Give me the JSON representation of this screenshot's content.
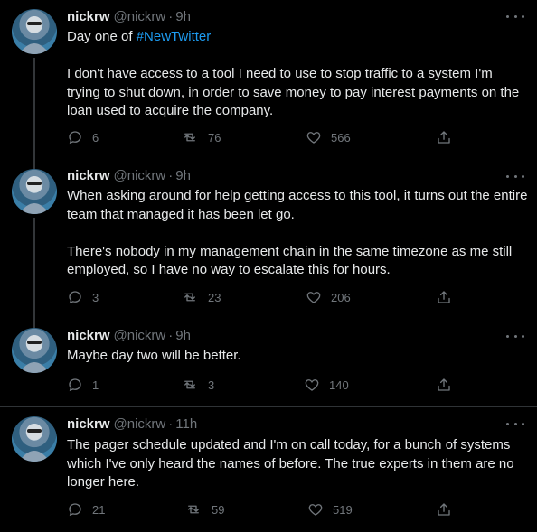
{
  "tweets": [
    {
      "name": "nickrw",
      "handle": "@nickrw",
      "time": "9h",
      "paragraphs": [
        "",
        "I don't have access to a tool I need to use to stop traffic to a system I'm trying to shut down, in order to save money to pay interest payments on the loan used to acquire the company."
      ],
      "first_line_prefix": "Day one of ",
      "hashtag": "#NewTwitter",
      "replies": "6",
      "retweets": "76",
      "likes": "566"
    },
    {
      "name": "nickrw",
      "handle": "@nickrw",
      "time": "9h",
      "paragraphs": [
        "When asking around for help getting access to this tool, it turns out the entire team that managed it has been let go.",
        "There's nobody in my management chain in the same timezone as me still employed, so I have no way to escalate this for hours."
      ],
      "replies": "3",
      "retweets": "23",
      "likes": "206"
    },
    {
      "name": "nickrw",
      "handle": "@nickrw",
      "time": "9h",
      "paragraphs": [
        "Maybe day two will be better."
      ],
      "replies": "1",
      "retweets": "3",
      "likes": "140"
    },
    {
      "name": "nickrw",
      "handle": "@nickrw",
      "time": "11h",
      "paragraphs": [
        "The pager schedule updated and I'm on call today, for a bunch of systems which I've only heard the names of before. The true experts in them are no longer here."
      ],
      "replies": "21",
      "retweets": "59",
      "likes": "519"
    }
  ],
  "separator": "·",
  "colors": {
    "background": "#000000",
    "text": "#e7e9ea",
    "secondary": "#71767b",
    "link": "#1d9bf0",
    "divider": "#2f3336"
  },
  "icons": [
    "reply-icon",
    "retweet-icon",
    "like-icon",
    "share-icon",
    "more-icon"
  ]
}
